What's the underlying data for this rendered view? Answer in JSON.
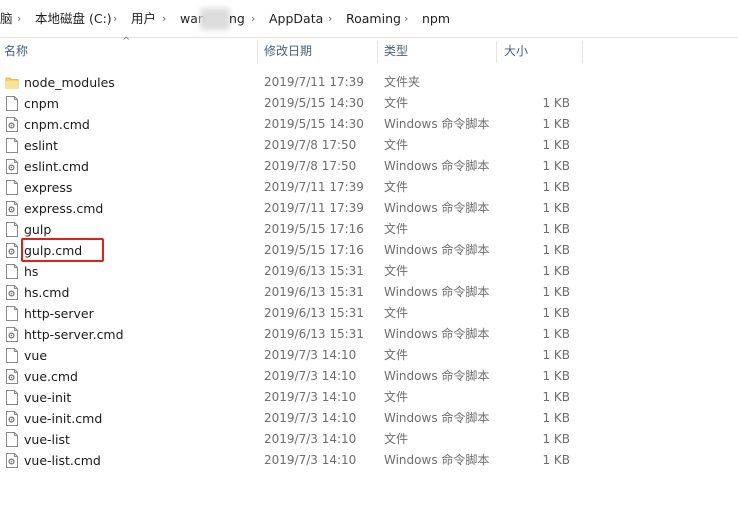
{
  "breadcrumb": [
    "脑",
    "本地磁盘 (C:)",
    "用户",
    "wan",
    "ng",
    "AppData",
    "Roaming",
    "npm"
  ],
  "columns": {
    "name": "名称",
    "modified": "修改日期",
    "type": "类型",
    "size": "大小"
  },
  "files": [
    {
      "name": "node_modules",
      "date": "2019/7/11 17:39",
      "type": "文件夹",
      "size": "",
      "icon": "folder-icon"
    },
    {
      "name": "cnpm",
      "date": "2019/5/15 14:30",
      "type": "文件",
      "size": "1 KB",
      "icon": "file-icon"
    },
    {
      "name": "cnpm.cmd",
      "date": "2019/5/15 14:30",
      "type": "Windows 命令脚本",
      "size": "1 KB",
      "icon": "cmd-script-icon"
    },
    {
      "name": "eslint",
      "date": "2019/7/8 17:50",
      "type": "文件",
      "size": "1 KB",
      "icon": "file-icon"
    },
    {
      "name": "eslint.cmd",
      "date": "2019/7/8 17:50",
      "type": "Windows 命令脚本",
      "size": "1 KB",
      "icon": "cmd-script-icon"
    },
    {
      "name": "express",
      "date": "2019/7/11 17:39",
      "type": "文件",
      "size": "1 KB",
      "icon": "file-icon"
    },
    {
      "name": "express.cmd",
      "date": "2019/7/11 17:39",
      "type": "Windows 命令脚本",
      "size": "1 KB",
      "icon": "cmd-script-icon"
    },
    {
      "name": "gulp",
      "date": "2019/5/15 17:16",
      "type": "文件",
      "size": "1 KB",
      "icon": "file-icon"
    },
    {
      "name": "gulp.cmd",
      "date": "2019/5/15 17:16",
      "type": "Windows 命令脚本",
      "size": "1 KB",
      "icon": "cmd-script-icon"
    },
    {
      "name": "hs",
      "date": "2019/6/13 15:31",
      "type": "文件",
      "size": "1 KB",
      "icon": "file-icon"
    },
    {
      "name": "hs.cmd",
      "date": "2019/6/13 15:31",
      "type": "Windows 命令脚本",
      "size": "1 KB",
      "icon": "cmd-script-icon"
    },
    {
      "name": "http-server",
      "date": "2019/6/13 15:31",
      "type": "文件",
      "size": "1 KB",
      "icon": "file-icon"
    },
    {
      "name": "http-server.cmd",
      "date": "2019/6/13 15:31",
      "type": "Windows 命令脚本",
      "size": "1 KB",
      "icon": "cmd-script-icon"
    },
    {
      "name": "vue",
      "date": "2019/7/3 14:10",
      "type": "文件",
      "size": "1 KB",
      "icon": "file-icon"
    },
    {
      "name": "vue.cmd",
      "date": "2019/7/3 14:10",
      "type": "Windows 命令脚本",
      "size": "1 KB",
      "icon": "cmd-script-icon"
    },
    {
      "name": "vue-init",
      "date": "2019/7/3 14:10",
      "type": "文件",
      "size": "1 KB",
      "icon": "file-icon"
    },
    {
      "name": "vue-init.cmd",
      "date": "2019/7/3 14:10",
      "type": "Windows 命令脚本",
      "size": "1 KB",
      "icon": "cmd-script-icon"
    },
    {
      "name": "vue-list",
      "date": "2019/7/3 14:10",
      "type": "文件",
      "size": "1 KB",
      "icon": "file-icon"
    },
    {
      "name": "vue-list.cmd",
      "date": "2019/7/3 14:10",
      "type": "Windows 命令脚本",
      "size": "1 KB",
      "icon": "cmd-script-icon"
    }
  ],
  "colors": {
    "highlight": "#e0201b",
    "folder": "#f7d36b",
    "header_text": "#4c607a"
  }
}
